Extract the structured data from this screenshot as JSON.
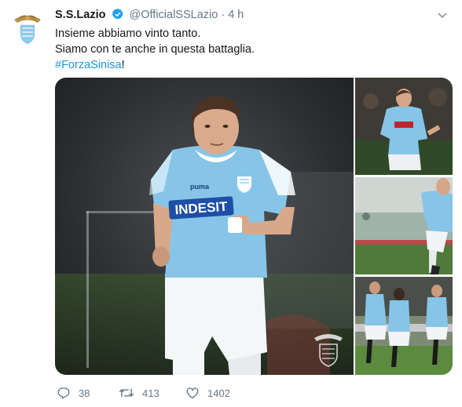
{
  "tweet": {
    "author_name": "S.S.Lazio",
    "handle": "@OfficialSSLazio",
    "separator": "·",
    "time": "4 h",
    "lines": [
      "Insieme abbiamo vinto tanto.",
      "Siamo con te anche in questa battaglia."
    ],
    "hashtag": "#ForzaSinisa",
    "hashtag_suffix": "!",
    "jersey_sponsor": "INDESIT",
    "jersey_brand": "puma"
  },
  "actions": {
    "replies": "38",
    "retweets": "413",
    "likes": "1402"
  },
  "colors": {
    "accent": "#1b95e0",
    "verified": "#1da1f2",
    "muted": "#657786",
    "jersey": "#86c5e8"
  }
}
